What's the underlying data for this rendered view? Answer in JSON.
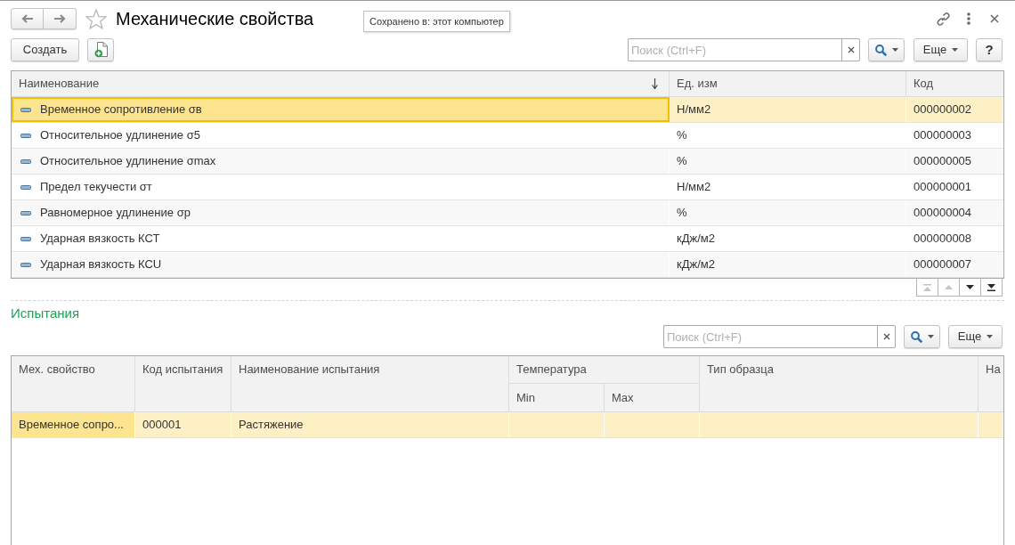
{
  "window": {
    "title": "Механические свойства",
    "favorite": false,
    "tooltip": "Сохранено в: этот компьютер"
  },
  "toolbar": {
    "create_button": "Создать",
    "search": {
      "placeholder": "Поиск (Ctrl+F)"
    },
    "more_button": "Еще",
    "help_button": "?"
  },
  "table": {
    "focused": true,
    "columns": [
      {
        "label": "Наименование",
        "sorted": true
      },
      {
        "label": "Ед. изм",
        "sorted": false
      },
      {
        "label": "Код",
        "sorted": false
      }
    ],
    "rows": [
      {
        "selected": true,
        "cells": [
          {
            "text": "Временное сопротивление σв",
            "current": true
          },
          {
            "text": "Н/мм2",
            "current": false
          },
          {
            "text": "000000002",
            "current": false
          }
        ]
      },
      {
        "selected": false,
        "cells": [
          {
            "text": "Относительное удлинение σ5",
            "current": false
          },
          {
            "text": "%",
            "current": false
          },
          {
            "text": "000000003",
            "current": false
          }
        ]
      },
      {
        "selected": false,
        "cells": [
          {
            "text": "Относительное удлинение σmax",
            "current": false
          },
          {
            "text": "%",
            "current": false
          },
          {
            "text": "000000005",
            "current": false
          }
        ]
      },
      {
        "selected": false,
        "cells": [
          {
            "text": "Предел текучести σт",
            "current": false
          },
          {
            "text": "Н/мм2",
            "current": false
          },
          {
            "text": "000000001",
            "current": false
          }
        ]
      },
      {
        "selected": false,
        "cells": [
          {
            "text": "Равномерное удлинение σр",
            "current": false
          },
          {
            "text": "%",
            "current": false
          },
          {
            "text": "000000004",
            "current": false
          }
        ]
      },
      {
        "selected": false,
        "cells": [
          {
            "text": "Ударная вязкость КСТ",
            "current": false
          },
          {
            "text": "кДж/м2",
            "current": false
          },
          {
            "text": "000000008",
            "current": false
          }
        ]
      },
      {
        "selected": false,
        "cells": [
          {
            "text": "Ударная вязкость КСU",
            "current": false
          },
          {
            "text": "кДж/м2",
            "current": false
          },
          {
            "text": "000000007",
            "current": false
          }
        ]
      }
    ]
  },
  "navigation": [
    {
      "kind": "first",
      "disabled": true
    },
    {
      "kind": "up",
      "disabled": true
    },
    {
      "kind": "down",
      "disabled": false
    },
    {
      "kind": "last",
      "disabled": false
    }
  ],
  "tests": {
    "title": "Испытания",
    "search": {
      "placeholder": "Поиск (Ctrl+F)"
    },
    "more_button": "Еще",
    "table": {
      "focused": false,
      "columns": [
        {
          "label": "Мех. свойство"
        },
        {
          "label": "Код испытания"
        },
        {
          "label": "Наименование испытания"
        },
        {
          "label": "Температура",
          "children": [
            {
              "label": "Min"
            },
            {
              "label": "Max"
            }
          ]
        },
        {
          "label": "Тип образца"
        },
        {
          "label": "На"
        }
      ],
      "rows": [
        {
          "selected": true,
          "cells": [
            {
              "text": "Временное сопро...",
              "current": true
            },
            {
              "text": "000001",
              "current": false
            },
            {
              "text": "Растяжение",
              "current": false
            }
          ]
        }
      ]
    }
  }
}
